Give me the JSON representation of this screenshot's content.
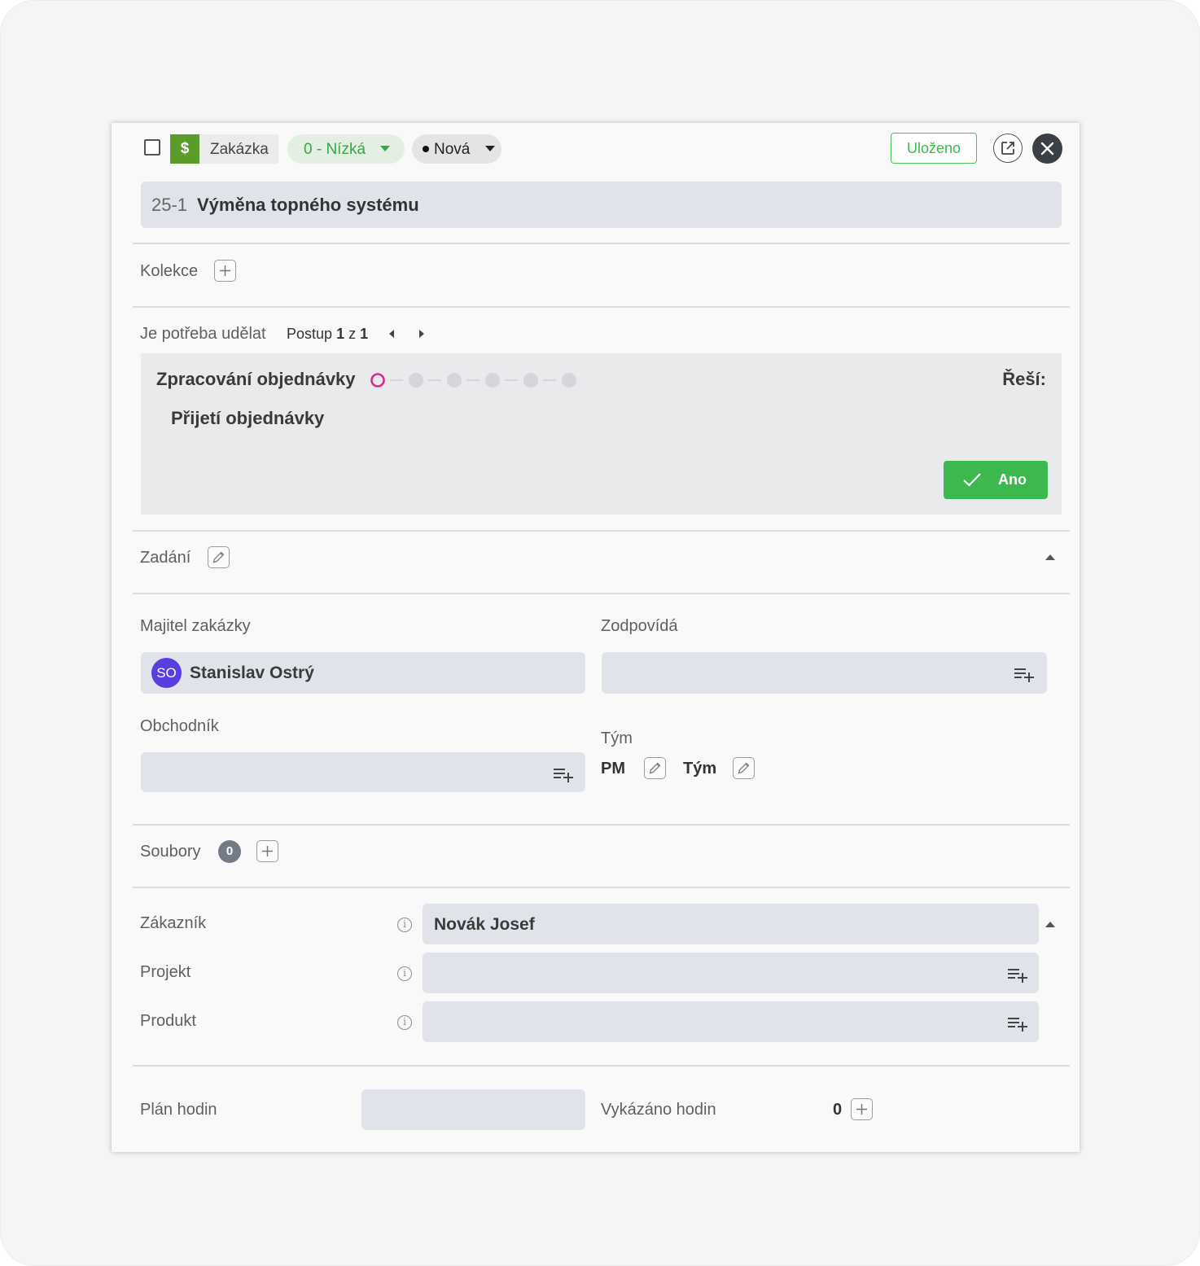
{
  "header": {
    "type_icon": "$",
    "type_label": "Zakázka",
    "priority_label": "0 - Nízká",
    "status_label": "Nová",
    "saved_label": "Uloženo"
  },
  "title": {
    "number": "25-1",
    "text": "Výměna topného systému"
  },
  "collections": {
    "label": "Kolekce"
  },
  "todo": {
    "label": "Je potřeba udělat",
    "progress_prefix": "Postup",
    "progress_current": "1",
    "progress_separator": "z",
    "progress_total": "1",
    "step_title": "Zpracování objednávky",
    "solver_label": "Řeší:",
    "substep": "Přijetí objednávky",
    "confirm_label": "Ano"
  },
  "assignment": {
    "label": "Zadání"
  },
  "people": {
    "owner_label": "Majitel zakázky",
    "owner_initials": "SO",
    "owner_name": "Stanislav Ostrý",
    "responsible_label": "Zodpovídá",
    "sales_label": "Obchodník",
    "team_label": "Tým",
    "pm_label": "PM",
    "team_sub_label": "Tým"
  },
  "files": {
    "label": "Soubory",
    "count": "0"
  },
  "relations": {
    "customer_label": "Zákazník",
    "customer_value": "Novák Josef",
    "project_label": "Projekt",
    "product_label": "Produkt"
  },
  "hours": {
    "plan_label": "Plán hodin",
    "reported_label": "Vykázáno hodin",
    "reported_value": "0"
  },
  "colors": {
    "accent_green": "#3db84e",
    "magenta": "#d92a8a",
    "avatar": "#5a3fe0",
    "dark_button": "#3b3f46"
  }
}
